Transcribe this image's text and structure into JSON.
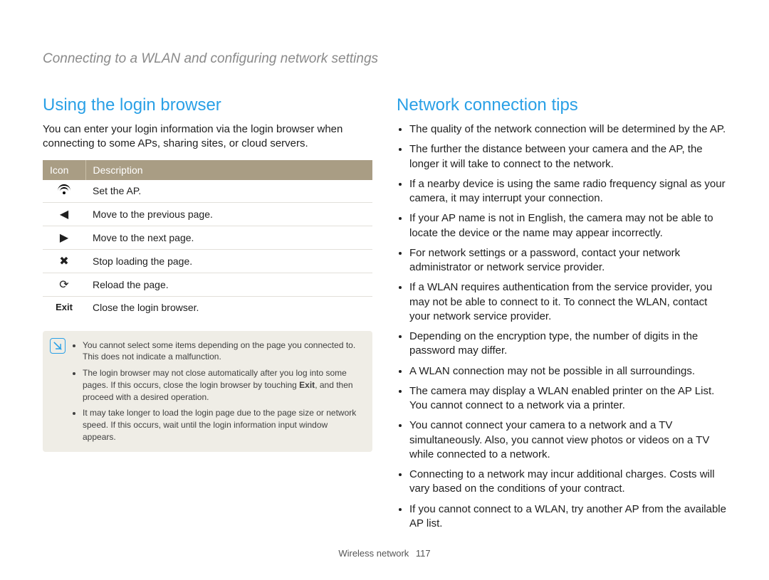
{
  "header": "Connecting to a WLAN and configuring network settings",
  "left": {
    "title": "Using the login browser",
    "intro": "You can enter your login information via the login browser when connecting to some APs, sharing sites, or cloud servers.",
    "table": {
      "head_icon": "Icon",
      "head_desc": "Description",
      "rows": [
        {
          "icon_name": "wifi-icon",
          "icon_text": "",
          "desc": "Set the AP."
        },
        {
          "icon_name": "triangle-left-icon",
          "icon_text": "◀",
          "desc": "Move to the previous page."
        },
        {
          "icon_name": "triangle-right-icon",
          "icon_text": "▶",
          "desc": "Move to the next page."
        },
        {
          "icon_name": "cross-icon",
          "icon_text": "✖",
          "desc": "Stop loading the page."
        },
        {
          "icon_name": "reload-icon",
          "icon_text": "⟳",
          "desc": "Reload the page."
        },
        {
          "icon_name": "exit-label",
          "icon_text": "Exit",
          "desc": "Close the login browser."
        }
      ]
    },
    "notes": {
      "n1": "You cannot select some items depending on the page you connected to. This does not indicate a malfunction.",
      "n2a": "The login browser may not close automatically after you log into some pages. If this occurs, close the login browser by touching ",
      "n2_exit": "Exit",
      "n2b": ", and then proceed with a desired operation.",
      "n3": "It may take longer to load the login page due to the page size or network speed. If this occurs, wait until the login information input window appears."
    }
  },
  "right": {
    "title": "Network connection tips",
    "tips": [
      "The quality of the network connection will be determined by the AP.",
      "The further the distance between your camera and the AP, the longer it will take to connect to the network.",
      "If a nearby device is using the same radio frequency signal as your camera, it may interrupt your connection.",
      "If your AP name is not in English, the camera may not be able to locate the device or the name may appear incorrectly.",
      "For network settings or a password, contact your network administrator or network service provider.",
      "If a WLAN requires authentication from the service provider, you may not be able to connect to it. To connect the WLAN, contact your network service provider.",
      "Depending on the encryption type, the number of digits in the password may differ.",
      "A WLAN connection may not be possible in all surroundings.",
      "The camera may display a WLAN enabled printer on the AP List. You cannot connect to a network via a printer.",
      "You cannot connect your camera to a network and a TV simultaneously. Also, you cannot view photos or videos on a TV while connected to a network.",
      "Connecting to a network may incur additional charges. Costs will vary based on the conditions of your contract.",
      "If you cannot connect to a WLAN, try another AP from the available AP list."
    ]
  },
  "footer": {
    "section": "Wireless network",
    "page": "117"
  }
}
